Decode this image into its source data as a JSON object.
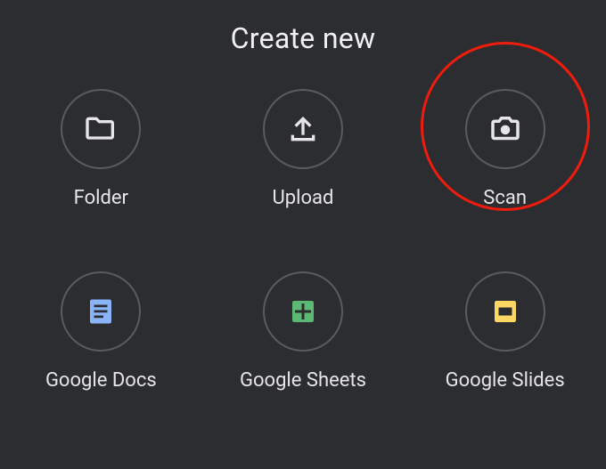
{
  "title": "Create new",
  "items": [
    {
      "id": "folder",
      "label": "Folder"
    },
    {
      "id": "upload",
      "label": "Upload"
    },
    {
      "id": "scan",
      "label": "Scan",
      "highlighted": true
    },
    {
      "id": "docs",
      "label": "Google Docs"
    },
    {
      "id": "sheets",
      "label": "Google Sheets"
    },
    {
      "id": "slides",
      "label": "Google Slides"
    }
  ],
  "colors": {
    "background": "#2c2d30",
    "circle_border": "#5a5b5e",
    "text": "#e6e6e6",
    "highlight": "#ef1c0e",
    "docs": "#8ab4f8",
    "sheets": "#5bb974",
    "slides": "#fdd663"
  }
}
